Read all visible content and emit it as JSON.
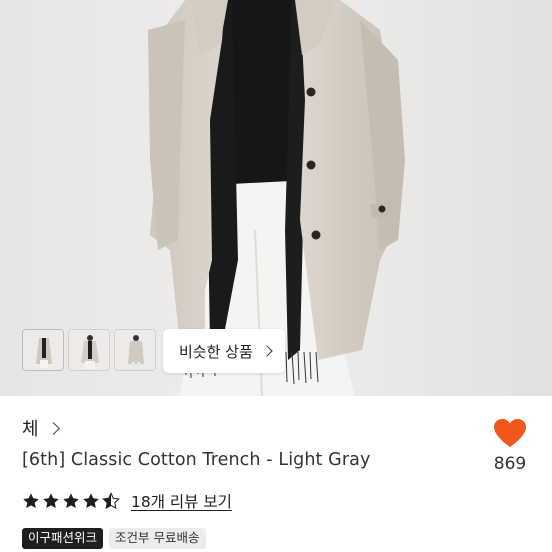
{
  "gallery": {
    "thumbnails": [
      {
        "label": "thumbnail-1"
      },
      {
        "label": "thumbnail-2"
      },
      {
        "label": "thumbnail-3"
      }
    ],
    "similar_products_label": "비슷한 상품"
  },
  "product": {
    "brand": "체",
    "title": "[6th] Classic Cotton Trench - Light Gray",
    "like_count": "869",
    "rating": 4.5,
    "review_label": "18개 리뷰 보기",
    "tags": [
      "이구패션위크",
      "조건부 무료배송"
    ]
  },
  "colors": {
    "heart": "#f2561d",
    "coat": "#d9d2ca",
    "background": "#e9e8e6",
    "star": "#1e1e1e"
  }
}
